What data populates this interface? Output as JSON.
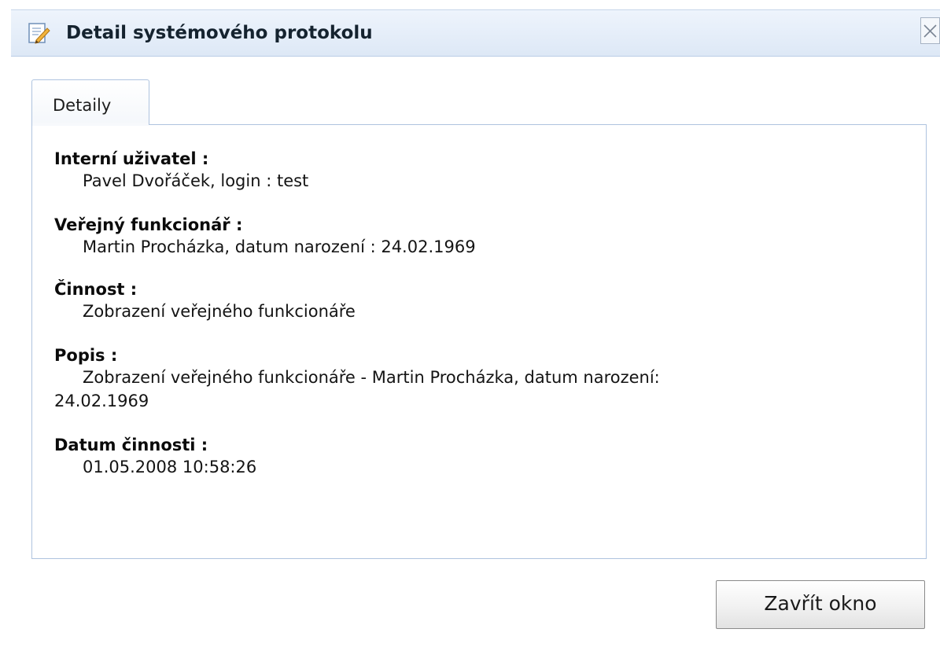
{
  "window": {
    "title": "Detail systémového protokolu"
  },
  "tabs": [
    {
      "label": "Detaily",
      "active": true
    }
  ],
  "details": {
    "internal_user": {
      "label": "Interní uživatel :",
      "value": "Pavel Dvořáček, login : test"
    },
    "public_official": {
      "label": "Veřejný funkcionář :",
      "value": "Martin Procházka, datum narození : 24.02.1969"
    },
    "activity": {
      "label": "Činnost :",
      "value": "Zobrazení veřejného funkcionáře"
    },
    "description": {
      "label": "Popis :",
      "value_line1": "Zobrazení veřejného funkcionáře - Martin Procházka, datum narození:",
      "value_line2": "24.02.1969"
    },
    "activity_date": {
      "label": "Datum činnosti :",
      "value": "01.05.2008 10:58:26"
    }
  },
  "footer": {
    "close_button_label": "Zavřít okno"
  },
  "icons": {
    "title": "edit-document-icon",
    "close": "close-icon"
  },
  "colors": {
    "titlebar": "#dde8f6",
    "border": "#aec3df"
  }
}
